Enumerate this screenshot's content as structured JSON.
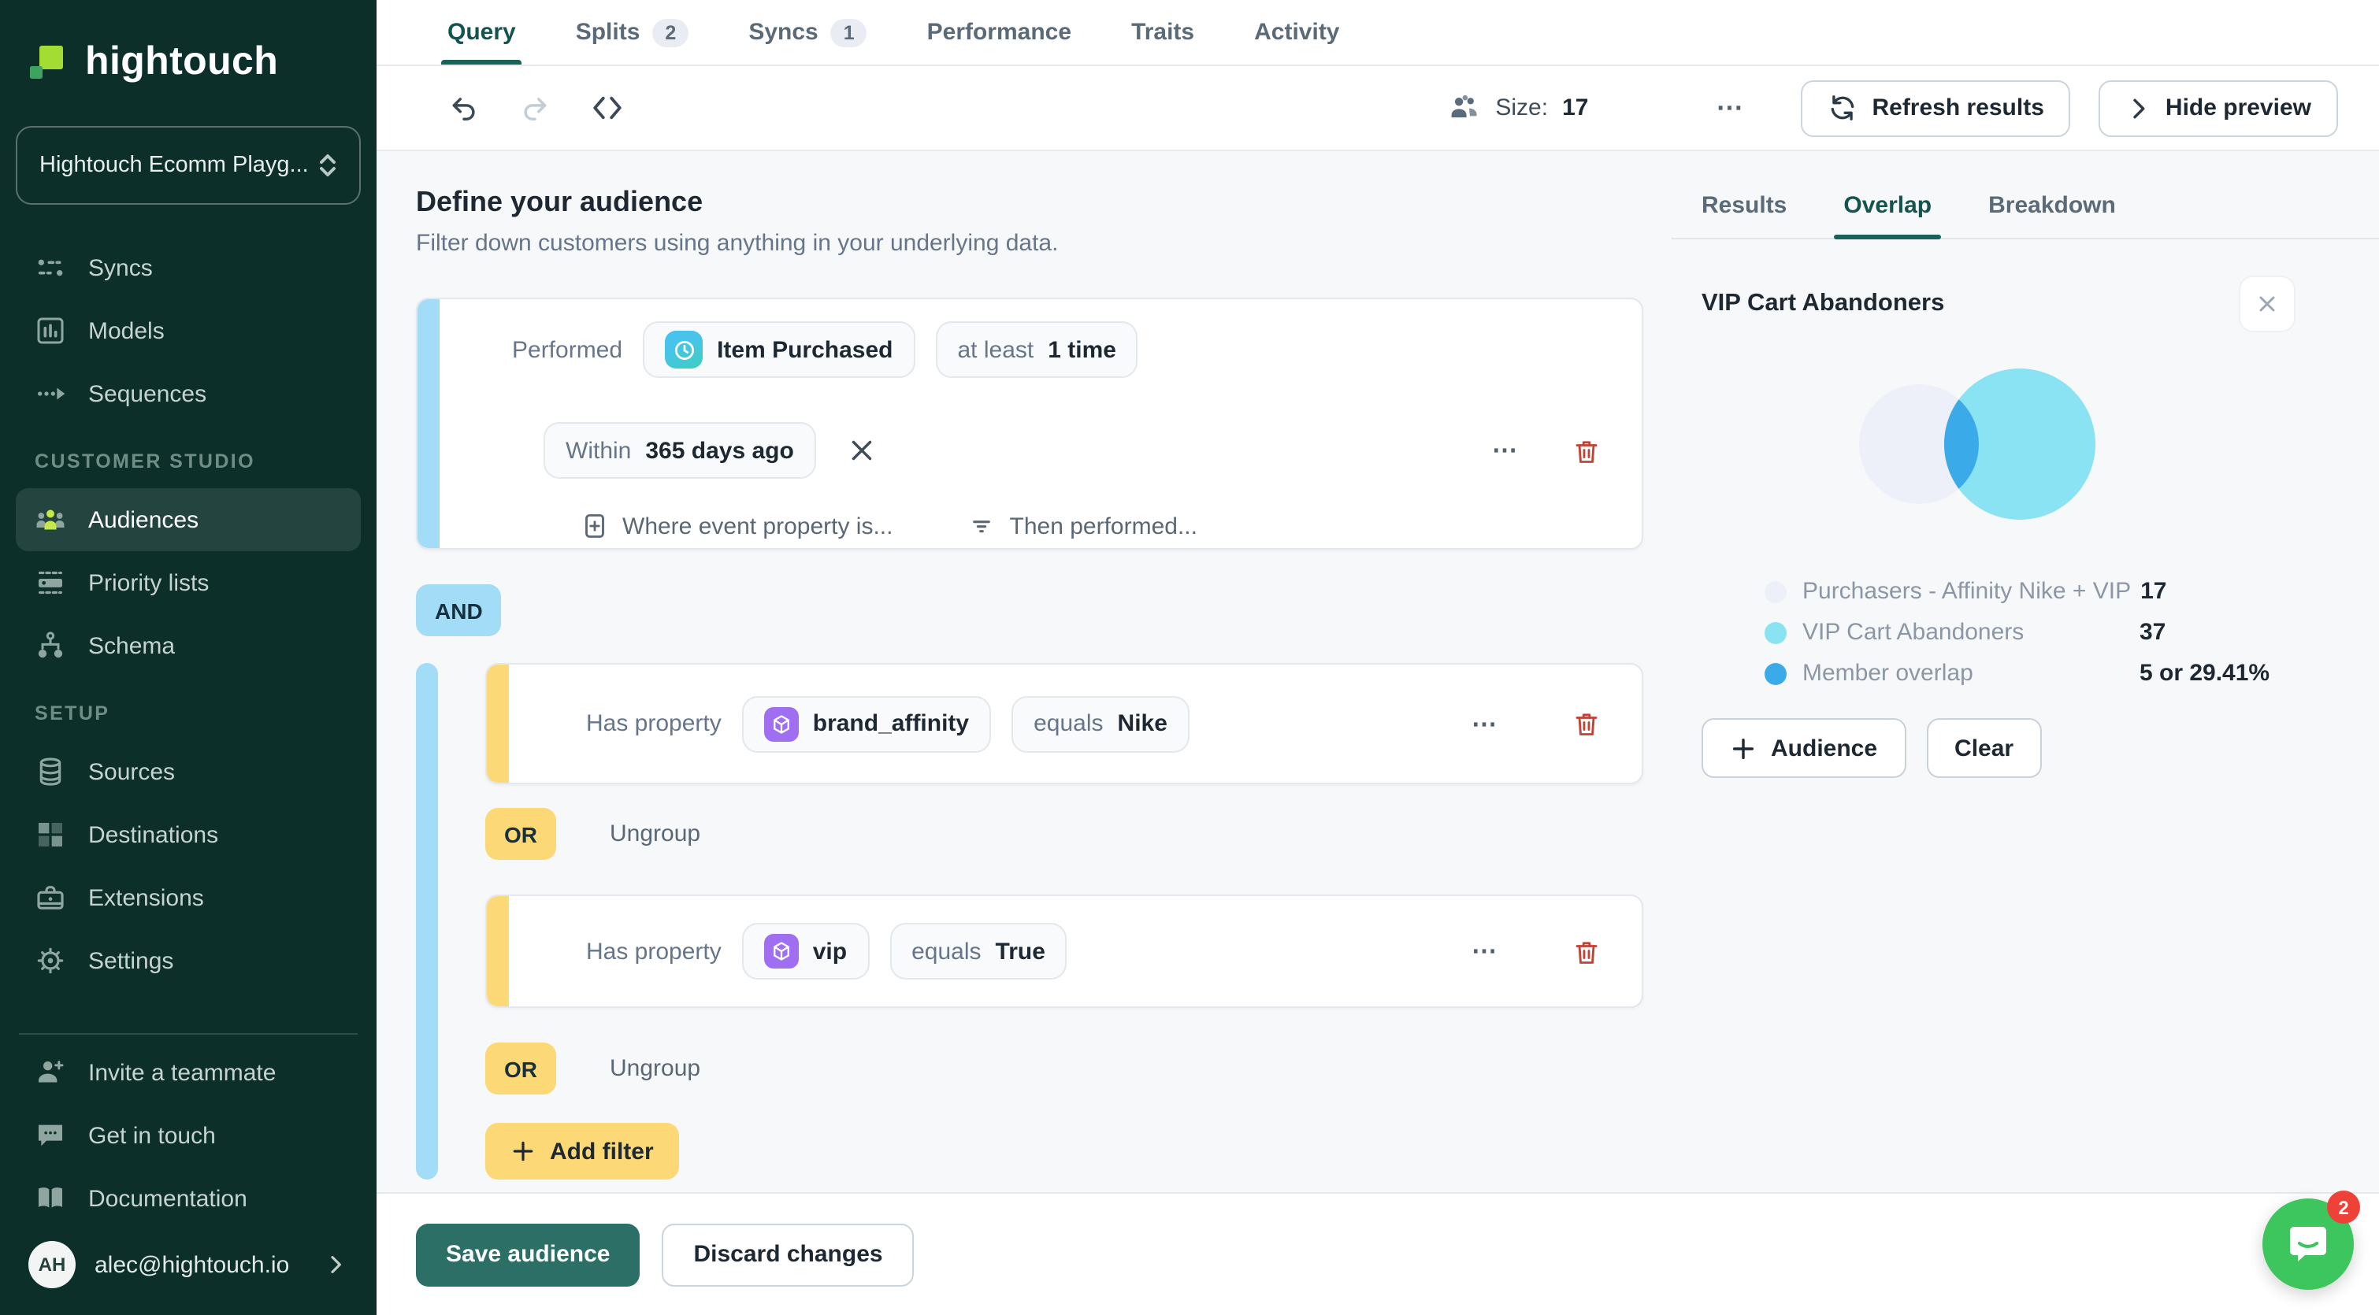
{
  "sidebar": {
    "logo_text": "hightouch",
    "workspace": {
      "name": "Hightouch Ecomm Playg..."
    },
    "nav_top": [
      {
        "label": "Syncs",
        "icon": "syncs-icon"
      },
      {
        "label": "Models",
        "icon": "models-icon"
      },
      {
        "label": "Sequences",
        "icon": "sequences-icon"
      }
    ],
    "sections": [
      {
        "title": "CUSTOMER STUDIO",
        "items": [
          {
            "label": "Audiences",
            "active": true,
            "icon": "audiences-icon"
          },
          {
            "label": "Priority lists",
            "icon": "priority-lists-icon"
          },
          {
            "label": "Schema",
            "icon": "schema-icon"
          }
        ]
      },
      {
        "title": "SETUP",
        "items": [
          {
            "label": "Sources",
            "icon": "sources-icon"
          },
          {
            "label": "Destinations",
            "icon": "destinations-icon"
          },
          {
            "label": "Extensions",
            "icon": "extensions-icon"
          },
          {
            "label": "Settings",
            "icon": "settings-icon"
          }
        ]
      }
    ],
    "bottom": [
      {
        "label": "Invite a teammate",
        "icon": "invite-teammate-icon"
      },
      {
        "label": "Get in touch",
        "icon": "chat-bubble-icon"
      },
      {
        "label": "Documentation",
        "icon": "documentation-icon"
      }
    ],
    "account": {
      "initials": "AH",
      "email": "alec@hightouch.io"
    }
  },
  "tabs": [
    {
      "label": "Query",
      "active": true
    },
    {
      "label": "Splits",
      "badge": "2"
    },
    {
      "label": "Syncs",
      "badge": "1"
    },
    {
      "label": "Performance"
    },
    {
      "label": "Traits"
    },
    {
      "label": "Activity"
    }
  ],
  "toolbar": {
    "size_label": "Size:",
    "size_value": "17",
    "more": "⋯",
    "refresh_label": "Refresh results",
    "hide_label": "Hide preview"
  },
  "builder": {
    "title": "Define your audience",
    "subtitle": "Filter down customers using anything in your underlying data.",
    "event_card": {
      "performed_label": "Performed",
      "event_name": "Item Purchased",
      "frequency_prefix": "at least",
      "frequency_value": "1 time",
      "window_prefix": "Within",
      "window_value": "365 days ago",
      "add_property_link": "Where event property is...",
      "then_performed_link": "Then performed...",
      "more": "⋯"
    },
    "and_label": "AND",
    "or_label": "OR",
    "ungroup_label": "Ungroup",
    "property_cards": [
      {
        "prefix": "Has property",
        "property": "brand_affinity",
        "operator": "equals",
        "value": "Nike",
        "more": "⋯"
      },
      {
        "prefix": "Has property",
        "property": "vip",
        "operator": "equals",
        "value": "True",
        "more": "⋯"
      }
    ],
    "add_filter_label": "Add filter",
    "save_label": "Save audience",
    "discard_label": "Discard changes"
  },
  "preview": {
    "tabs": [
      {
        "label": "Results"
      },
      {
        "label": "Overlap",
        "active": true
      },
      {
        "label": "Breakdown"
      }
    ],
    "title": "VIP Cart Abandoners",
    "overlap_chart": {
      "type": "venn",
      "sets": [
        {
          "label": "Purchasers - Affinity Nike + VIP",
          "value": "17",
          "color": "#edf0f8"
        },
        {
          "label": "VIP Cart Abandoners",
          "value": "37",
          "color": "#89e3f2"
        }
      ],
      "overlap": {
        "label": "Member overlap",
        "value": "5 or 29.41%",
        "overlap_count": 5,
        "overlap_pct": "29.41%",
        "color": "#3aaae9"
      }
    },
    "audience_button": "Audience",
    "clear_button": "Clear"
  },
  "chat": {
    "unread_count": "2"
  }
}
